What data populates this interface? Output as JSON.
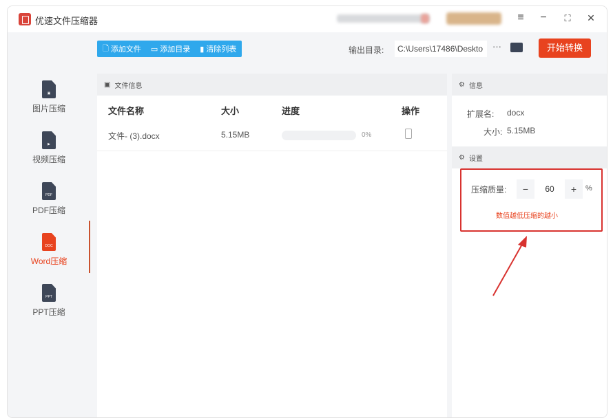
{
  "app": {
    "title": "优速文件压缩器"
  },
  "window_controls": {
    "menu": "≡",
    "minimize": "−",
    "maximize": "⛶",
    "close": "✕"
  },
  "toolbar": {
    "add_file": "添加文件",
    "add_folder": "添加目录",
    "clear_list": "清除列表",
    "output_label": "输出目录:",
    "output_path": "C:\\Users\\17486\\Deskto",
    "more": "···",
    "start": "开始转换"
  },
  "sidebar": {
    "items": [
      {
        "label": "图片压缩",
        "icon_text": "▣"
      },
      {
        "label": "视频压缩",
        "icon_text": "▶"
      },
      {
        "label": "PDF压缩",
        "icon_text": "PDF"
      },
      {
        "label": "Word压缩",
        "icon_text": "DOC"
      },
      {
        "label": "PPT压缩",
        "icon_text": "PPT"
      }
    ],
    "active": "Word压缩"
  },
  "file_panel": {
    "title": "文件信息",
    "columns": [
      "文件名称",
      "大小",
      "进度",
      "操作"
    ],
    "rows": [
      {
        "name": "文件- (3).docx",
        "size": "5.15MB",
        "progress": "0%"
      }
    ]
  },
  "info_panel": {
    "title": "信息",
    "ext_label": "扩展名:",
    "ext": "docx",
    "size_label": "大小:",
    "size": "5.15MB"
  },
  "settings_panel": {
    "title": "设置",
    "quality_label": "压缩质量:",
    "minus": "−",
    "quality": "60",
    "plus": "+",
    "unit": "%",
    "hint": "数值越低压缩的越小"
  },
  "colors": {
    "accent": "#e8431f",
    "blue": "#2fa8ec",
    "highlight": "#d8322f"
  }
}
